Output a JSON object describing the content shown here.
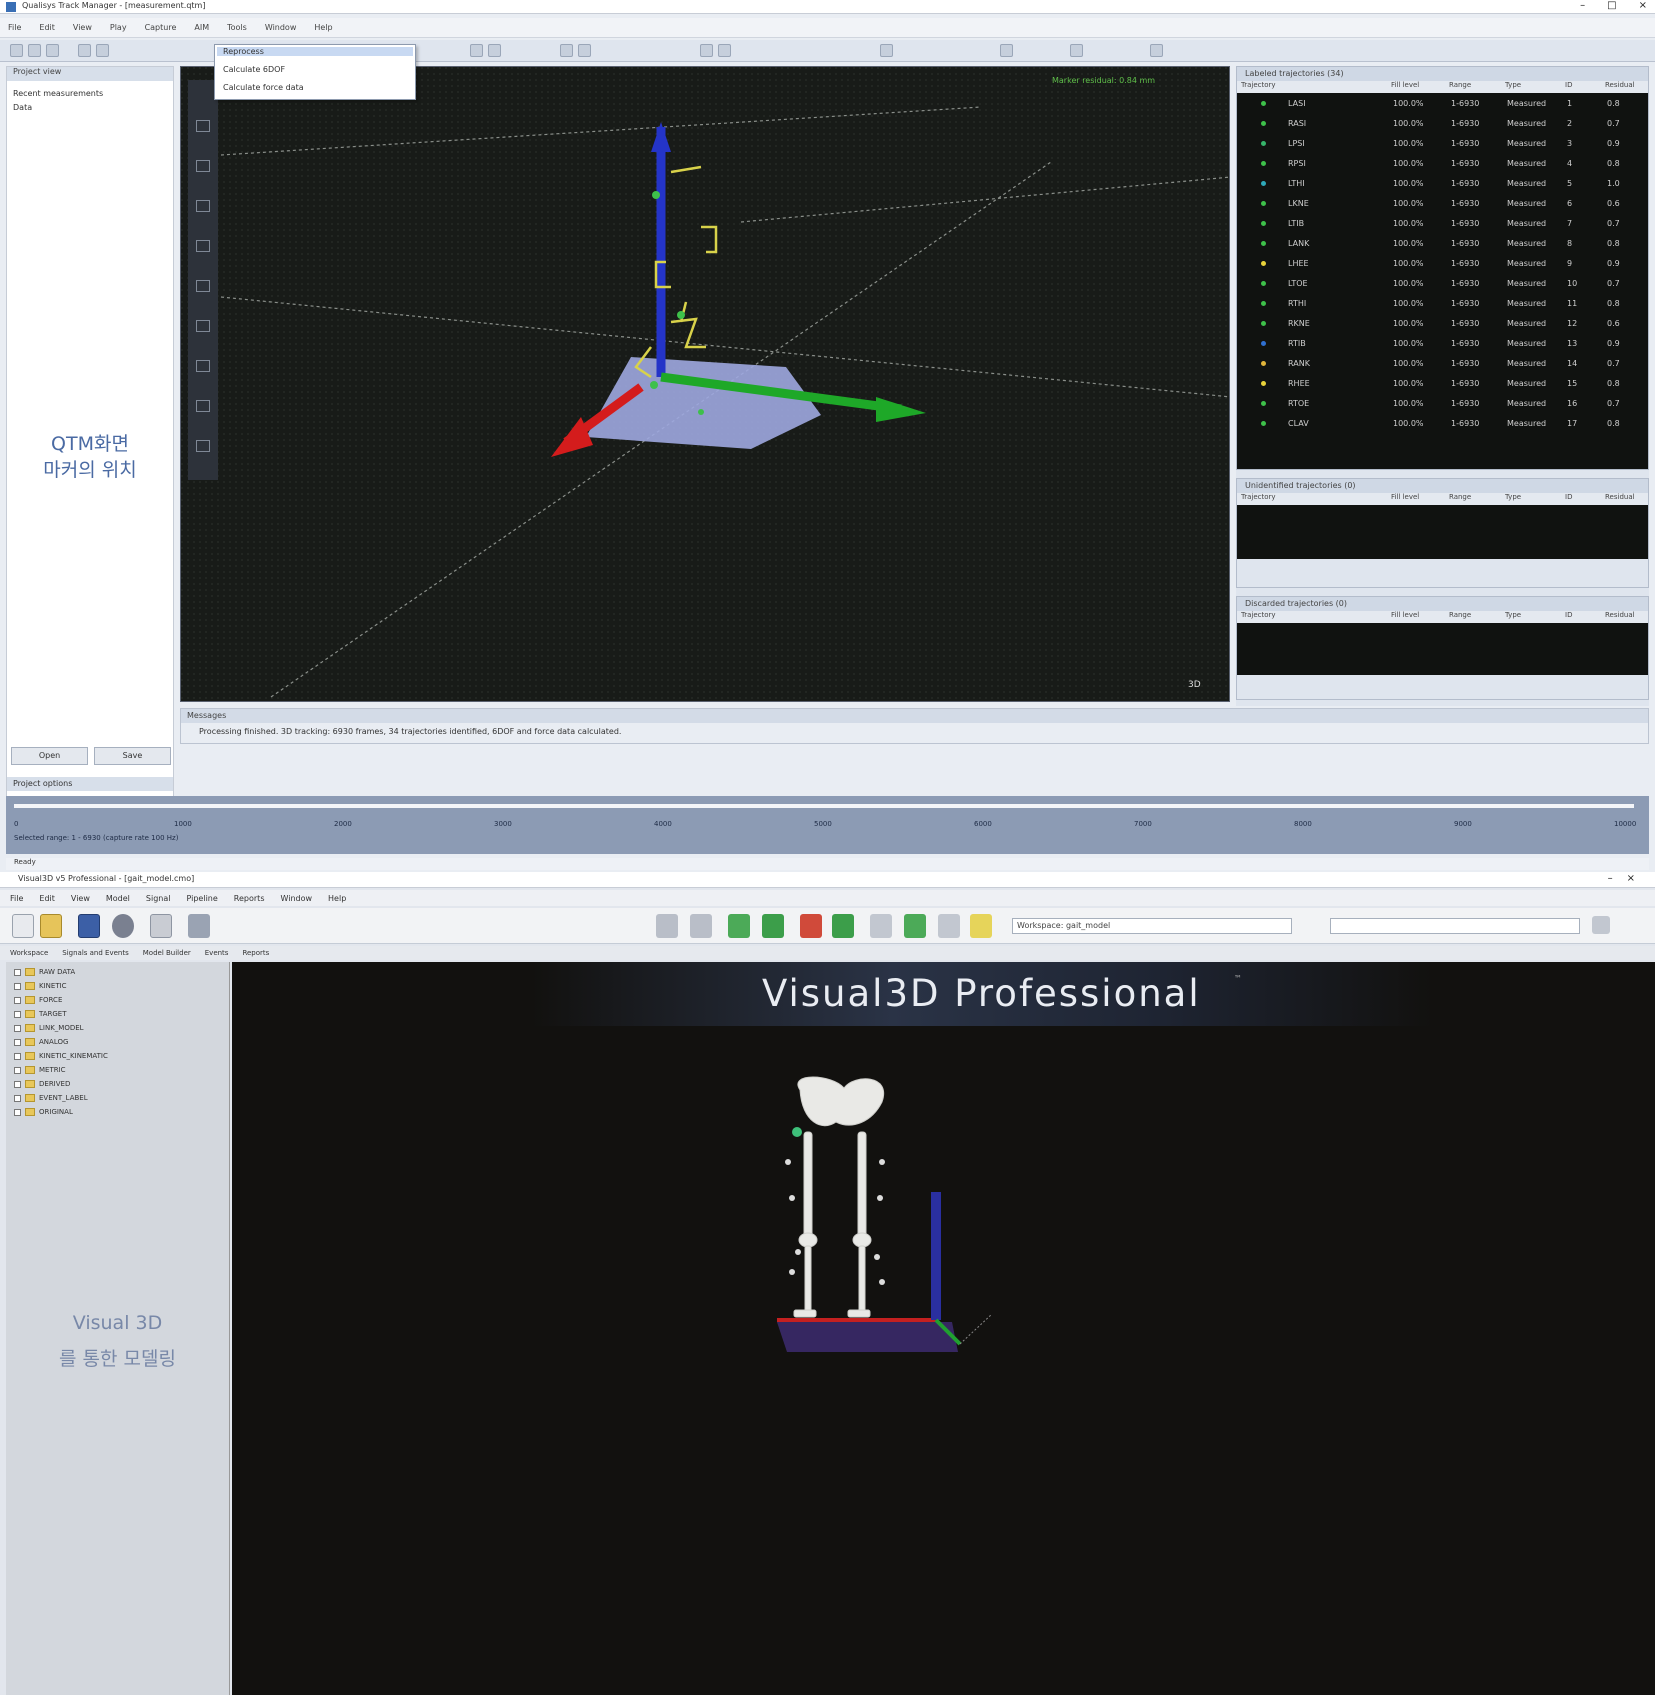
{
  "qtm": {
    "window_title": "Qualisys Track Manager - [measurement.qtm]",
    "window_controls": [
      "–",
      "□",
      "×"
    ],
    "menu": [
      "File",
      "Edit",
      "View",
      "Play",
      "Capture",
      "AIM",
      "Tools",
      "Window",
      "Help"
    ],
    "dropdown": {
      "items": [
        "Reprocess",
        "Calculate 6DOF",
        "Calculate force data"
      ]
    },
    "left_panel": {
      "header": "Project view",
      "rows": [
        "Recent measurements",
        "Data"
      ],
      "caption_line1": "QTM화면",
      "caption_line2": "마커의 위치",
      "buttons": [
        "Open",
        "Save"
      ],
      "footer": "Project options"
    },
    "viewport": {
      "info_text": "Marker residual: 0.84 mm",
      "frame_label": "3D"
    },
    "trajectory_info": {
      "title": "Labeled trajectories (34)",
      "columns": [
        "Trajectory",
        "Fill level",
        "Range",
        "Type",
        "ID",
        "Residual"
      ],
      "rows": [
        {
          "name": "LASI",
          "fill": "100.0%",
          "range": "1-6930",
          "type": "Measured",
          "id": "1",
          "res": "0.8",
          "color": "#3ec04a"
        },
        {
          "name": "RASI",
          "fill": "100.0%",
          "range": "1-6930",
          "type": "Measured",
          "id": "2",
          "res": "0.7",
          "color": "#3ec04a"
        },
        {
          "name": "LPSI",
          "fill": "100.0%",
          "range": "1-6930",
          "type": "Measured",
          "id": "3",
          "res": "0.9",
          "color": "#36b46a"
        },
        {
          "name": "RPSI",
          "fill": "100.0%",
          "range": "1-6930",
          "type": "Measured",
          "id": "4",
          "res": "0.8",
          "color": "#3ec04a"
        },
        {
          "name": "LTHI",
          "fill": "100.0%",
          "range": "1-6930",
          "type": "Measured",
          "id": "5",
          "res": "1.0",
          "color": "#2ea8b8"
        },
        {
          "name": "LKNE",
          "fill": "100.0%",
          "range": "1-6930",
          "type": "Measured",
          "id": "6",
          "res": "0.6",
          "color": "#3ec04a"
        },
        {
          "name": "LTIB",
          "fill": "100.0%",
          "range": "1-6930",
          "type": "Measured",
          "id": "7",
          "res": "0.7",
          "color": "#3ec04a"
        },
        {
          "name": "LANK",
          "fill": "100.0%",
          "range": "1-6930",
          "type": "Measured",
          "id": "8",
          "res": "0.8",
          "color": "#3ec04a"
        },
        {
          "name": "LHEE",
          "fill": "100.0%",
          "range": "1-6930",
          "type": "Measured",
          "id": "9",
          "res": "0.9",
          "color": "#e8d23a"
        },
        {
          "name": "LTOE",
          "fill": "100.0%",
          "range": "1-6930",
          "type": "Measured",
          "id": "10",
          "res": "0.7",
          "color": "#3ec04a"
        },
        {
          "name": "RTHI",
          "fill": "100.0%",
          "range": "1-6930",
          "type": "Measured",
          "id": "11",
          "res": "0.8",
          "color": "#3ec04a"
        },
        {
          "name": "RKNE",
          "fill": "100.0%",
          "range": "1-6930",
          "type": "Measured",
          "id": "12",
          "res": "0.6",
          "color": "#3ec04a"
        },
        {
          "name": "RTIB",
          "fill": "100.0%",
          "range": "1-6930",
          "type": "Measured",
          "id": "13",
          "res": "0.9",
          "color": "#2f6fd0"
        },
        {
          "name": "RANK",
          "fill": "100.0%",
          "range": "1-6930",
          "type": "Measured",
          "id": "14",
          "res": "0.7",
          "color": "#e0b43a"
        },
        {
          "name": "RHEE",
          "fill": "100.0%",
          "range": "1-6930",
          "type": "Measured",
          "id": "15",
          "res": "0.8",
          "color": "#e8d23a"
        },
        {
          "name": "RTOE",
          "fill": "100.0%",
          "range": "1-6930",
          "type": "Measured",
          "id": "16",
          "res": "0.7",
          "color": "#3ec04a"
        },
        {
          "name": "CLAV",
          "fill": "100.0%",
          "range": "1-6930",
          "type": "Measured",
          "id": "17",
          "res": "0.8",
          "color": "#3ec04a"
        }
      ]
    },
    "unidentified": {
      "title": "Unidentified trajectories (0)",
      "columns": [
        "Trajectory",
        "Fill level",
        "Range",
        "Type",
        "ID",
        "Residual"
      ]
    },
    "discarded": {
      "title": "Discarded trajectories (0)",
      "columns": [
        "Trajectory",
        "Fill level",
        "Range",
        "Type",
        "ID",
        "Residual"
      ]
    },
    "messages": {
      "title": "Messages",
      "text": "Processing finished. 3D tracking: 6930 frames, 34 trajectories identified, 6DOF and force data calculated."
    },
    "timeline": {
      "ticks": [
        "0",
        "1000",
        "2000",
        "3000",
        "4000",
        "5000",
        "6000",
        "7000",
        "8000",
        "9000",
        "10000"
      ],
      "info": "Selected range: 1 - 6930 (capture rate 100 Hz)"
    },
    "status": "Ready"
  },
  "visual3d": {
    "window_title": "Visual3D v5 Professional - [gait_model.cmo]",
    "window_controls": [
      "–",
      "×"
    ],
    "menu": [
      "File",
      "Edit",
      "View",
      "Model",
      "Signal",
      "Pipeline",
      "Reports",
      "Window",
      "Help"
    ],
    "pipeline_field": "Workspace: gait_model",
    "field2": "",
    "tabs": [
      "Workspace",
      "Signals and Events",
      "Model Builder",
      "Events",
      "Reports"
    ],
    "tree": [
      "RAW DATA",
      "KINETIC",
      "FORCE",
      "TARGET",
      "LINK_MODEL",
      "ANALOG",
      "KINETIC_KINEMATIC",
      "METRIC",
      "DERIVED",
      "EVENT_LABEL",
      "ORIGINAL"
    ],
    "tree_caption_line1": "Visual 3D",
    "tree_caption_line2": "를 통한 모델링",
    "brand": "Visual3D Professional",
    "brand_mark": "™"
  }
}
